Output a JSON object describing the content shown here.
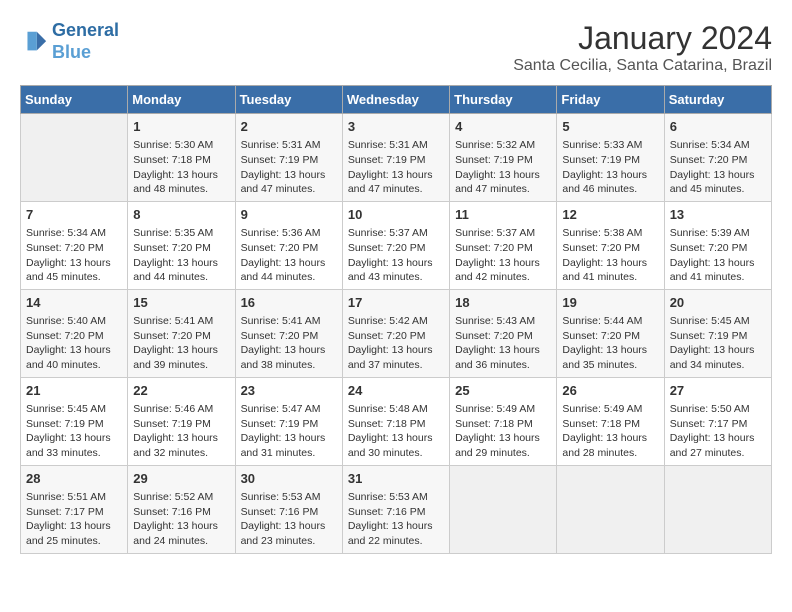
{
  "header": {
    "logo_line1": "General",
    "logo_line2": "Blue",
    "main_title": "January 2024",
    "subtitle": "Santa Cecilia, Santa Catarina, Brazil"
  },
  "days_of_week": [
    "Sunday",
    "Monday",
    "Tuesday",
    "Wednesday",
    "Thursday",
    "Friday",
    "Saturday"
  ],
  "weeks": [
    [
      {
        "day": "",
        "content": ""
      },
      {
        "day": "1",
        "content": "Sunrise: 5:30 AM\nSunset: 7:18 PM\nDaylight: 13 hours\nand 48 minutes."
      },
      {
        "day": "2",
        "content": "Sunrise: 5:31 AM\nSunset: 7:19 PM\nDaylight: 13 hours\nand 47 minutes."
      },
      {
        "day": "3",
        "content": "Sunrise: 5:31 AM\nSunset: 7:19 PM\nDaylight: 13 hours\nand 47 minutes."
      },
      {
        "day": "4",
        "content": "Sunrise: 5:32 AM\nSunset: 7:19 PM\nDaylight: 13 hours\nand 47 minutes."
      },
      {
        "day": "5",
        "content": "Sunrise: 5:33 AM\nSunset: 7:19 PM\nDaylight: 13 hours\nand 46 minutes."
      },
      {
        "day": "6",
        "content": "Sunrise: 5:34 AM\nSunset: 7:20 PM\nDaylight: 13 hours\nand 45 minutes."
      }
    ],
    [
      {
        "day": "7",
        "content": "Sunrise: 5:34 AM\nSunset: 7:20 PM\nDaylight: 13 hours\nand 45 minutes."
      },
      {
        "day": "8",
        "content": "Sunrise: 5:35 AM\nSunset: 7:20 PM\nDaylight: 13 hours\nand 44 minutes."
      },
      {
        "day": "9",
        "content": "Sunrise: 5:36 AM\nSunset: 7:20 PM\nDaylight: 13 hours\nand 44 minutes."
      },
      {
        "day": "10",
        "content": "Sunrise: 5:37 AM\nSunset: 7:20 PM\nDaylight: 13 hours\nand 43 minutes."
      },
      {
        "day": "11",
        "content": "Sunrise: 5:37 AM\nSunset: 7:20 PM\nDaylight: 13 hours\nand 42 minutes."
      },
      {
        "day": "12",
        "content": "Sunrise: 5:38 AM\nSunset: 7:20 PM\nDaylight: 13 hours\nand 41 minutes."
      },
      {
        "day": "13",
        "content": "Sunrise: 5:39 AM\nSunset: 7:20 PM\nDaylight: 13 hours\nand 41 minutes."
      }
    ],
    [
      {
        "day": "14",
        "content": "Sunrise: 5:40 AM\nSunset: 7:20 PM\nDaylight: 13 hours\nand 40 minutes."
      },
      {
        "day": "15",
        "content": "Sunrise: 5:41 AM\nSunset: 7:20 PM\nDaylight: 13 hours\nand 39 minutes."
      },
      {
        "day": "16",
        "content": "Sunrise: 5:41 AM\nSunset: 7:20 PM\nDaylight: 13 hours\nand 38 minutes."
      },
      {
        "day": "17",
        "content": "Sunrise: 5:42 AM\nSunset: 7:20 PM\nDaylight: 13 hours\nand 37 minutes."
      },
      {
        "day": "18",
        "content": "Sunrise: 5:43 AM\nSunset: 7:20 PM\nDaylight: 13 hours\nand 36 minutes."
      },
      {
        "day": "19",
        "content": "Sunrise: 5:44 AM\nSunset: 7:20 PM\nDaylight: 13 hours\nand 35 minutes."
      },
      {
        "day": "20",
        "content": "Sunrise: 5:45 AM\nSunset: 7:19 PM\nDaylight: 13 hours\nand 34 minutes."
      }
    ],
    [
      {
        "day": "21",
        "content": "Sunrise: 5:45 AM\nSunset: 7:19 PM\nDaylight: 13 hours\nand 33 minutes."
      },
      {
        "day": "22",
        "content": "Sunrise: 5:46 AM\nSunset: 7:19 PM\nDaylight: 13 hours\nand 32 minutes."
      },
      {
        "day": "23",
        "content": "Sunrise: 5:47 AM\nSunset: 7:19 PM\nDaylight: 13 hours\nand 31 minutes."
      },
      {
        "day": "24",
        "content": "Sunrise: 5:48 AM\nSunset: 7:18 PM\nDaylight: 13 hours\nand 30 minutes."
      },
      {
        "day": "25",
        "content": "Sunrise: 5:49 AM\nSunset: 7:18 PM\nDaylight: 13 hours\nand 29 minutes."
      },
      {
        "day": "26",
        "content": "Sunrise: 5:49 AM\nSunset: 7:18 PM\nDaylight: 13 hours\nand 28 minutes."
      },
      {
        "day": "27",
        "content": "Sunrise: 5:50 AM\nSunset: 7:17 PM\nDaylight: 13 hours\nand 27 minutes."
      }
    ],
    [
      {
        "day": "28",
        "content": "Sunrise: 5:51 AM\nSunset: 7:17 PM\nDaylight: 13 hours\nand 25 minutes."
      },
      {
        "day": "29",
        "content": "Sunrise: 5:52 AM\nSunset: 7:16 PM\nDaylight: 13 hours\nand 24 minutes."
      },
      {
        "day": "30",
        "content": "Sunrise: 5:53 AM\nSunset: 7:16 PM\nDaylight: 13 hours\nand 23 minutes."
      },
      {
        "day": "31",
        "content": "Sunrise: 5:53 AM\nSunset: 7:16 PM\nDaylight: 13 hours\nand 22 minutes."
      },
      {
        "day": "",
        "content": ""
      },
      {
        "day": "",
        "content": ""
      },
      {
        "day": "",
        "content": ""
      }
    ]
  ]
}
